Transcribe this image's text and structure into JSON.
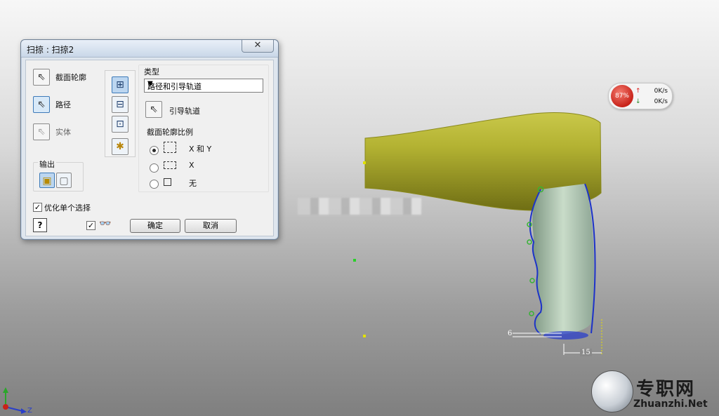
{
  "dialog": {
    "title": "扫掠 : 扫掠2",
    "close_label": "✕",
    "left_buttons": [
      {
        "label": "截面轮廓"
      },
      {
        "label": "路径"
      },
      {
        "label": "实体"
      }
    ],
    "output_label": "输出",
    "type_label": "类型",
    "type_select_value": "路径和引导轨道",
    "guide_rail_label": "引导轨道",
    "profile_scale_label": "截面轮廓比例",
    "scale_options": [
      {
        "label": "X 和 Y",
        "selected": true
      },
      {
        "label": "X",
        "selected": false
      },
      {
        "label": "无",
        "selected": false
      }
    ],
    "optimize_label": "优化单个选择",
    "optimize_checked": true,
    "preview_checked": true,
    "ok_label": "确定",
    "cancel_label": "取消",
    "help_label": "?"
  },
  "net_widget": {
    "percent": "87%",
    "upload": "0K/s",
    "download": "0K/s"
  },
  "model": {
    "dimension_left": "6",
    "dimension_bottom": "15"
  },
  "watermark": {
    "cn": "专职网",
    "en": "Zhuanzhi.Net"
  },
  "axis": {
    "z_label": "Z"
  },
  "colors": {
    "barrel": "#a4a52a",
    "handle": "#a9c3b0",
    "path_line": "#1c33c8",
    "accent": "#3d7ab8"
  }
}
